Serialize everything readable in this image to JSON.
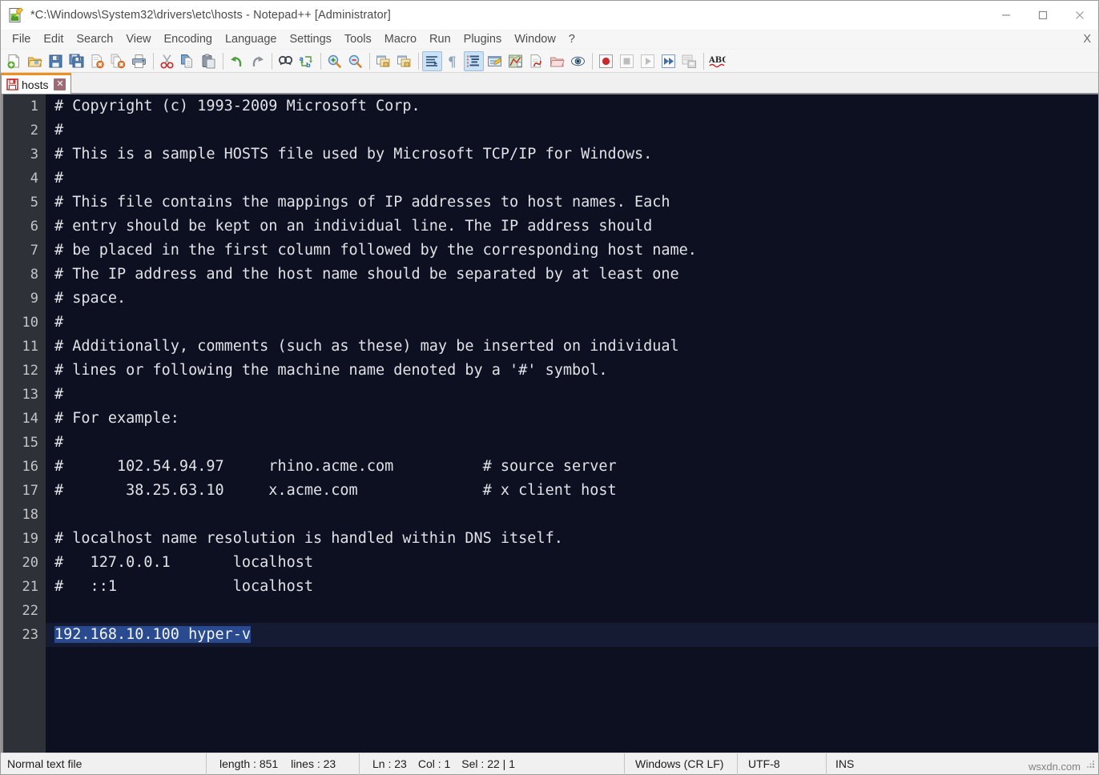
{
  "window": {
    "title": "*C:\\Windows\\System32\\drivers\\etc\\hosts - Notepad++ [Administrator]",
    "icon": "notepad-plus-plus-document-icon",
    "controls": {
      "minimize": "—",
      "maximize": "□",
      "close": "✕"
    }
  },
  "menubar": {
    "items": [
      {
        "label": "File"
      },
      {
        "label": "Edit"
      },
      {
        "label": "Search"
      },
      {
        "label": "View"
      },
      {
        "label": "Encoding"
      },
      {
        "label": "Language"
      },
      {
        "label": "Settings"
      },
      {
        "label": "Tools"
      },
      {
        "label": "Macro"
      },
      {
        "label": "Run"
      },
      {
        "label": "Plugins"
      },
      {
        "label": "Window"
      },
      {
        "label": "?"
      }
    ],
    "close_document_label": "X"
  },
  "toolbar": {
    "buttons": [
      {
        "name": "new-file-icon",
        "title": "New"
      },
      {
        "name": "open-file-icon",
        "title": "Open"
      },
      {
        "name": "save-icon",
        "title": "Save"
      },
      {
        "name": "save-all-icon",
        "title": "Save All"
      },
      {
        "name": "close-file-icon",
        "title": "Close"
      },
      {
        "name": "close-all-files-icon",
        "title": "Close All"
      },
      {
        "name": "print-icon",
        "title": "Print"
      },
      {
        "name": "separator-1",
        "title": ""
      },
      {
        "name": "cut-icon",
        "title": "Cut"
      },
      {
        "name": "copy-icon",
        "title": "Copy"
      },
      {
        "name": "paste-icon",
        "title": "Paste"
      },
      {
        "name": "separator-2",
        "title": ""
      },
      {
        "name": "undo-icon",
        "title": "Undo"
      },
      {
        "name": "redo-icon",
        "title": "Redo"
      },
      {
        "name": "separator-3",
        "title": ""
      },
      {
        "name": "find-icon",
        "title": "Find"
      },
      {
        "name": "replace-icon",
        "title": "Replace"
      },
      {
        "name": "separator-4",
        "title": ""
      },
      {
        "name": "zoom-in-icon",
        "title": "Zoom In"
      },
      {
        "name": "zoom-out-icon",
        "title": "Zoom Out"
      },
      {
        "name": "separator-5",
        "title": ""
      },
      {
        "name": "sync-vertical-scroll-icon",
        "title": "Synchronize Vertical Scrolling"
      },
      {
        "name": "sync-horizontal-scroll-icon",
        "title": "Synchronize Horizontal Scrolling"
      },
      {
        "name": "separator-6",
        "title": ""
      },
      {
        "name": "word-wrap-icon",
        "title": "Word wrap",
        "active": true
      },
      {
        "name": "show-all-characters-icon",
        "title": "Show All Characters"
      },
      {
        "name": "indent-guide-icon",
        "title": "Show Indent Guide",
        "active": true
      },
      {
        "name": "user-defined-language-icon",
        "title": "User-Defined Dialogue"
      },
      {
        "name": "document-map-icon",
        "title": "Document Map"
      },
      {
        "name": "function-list-icon",
        "title": "Function List"
      },
      {
        "name": "folder-as-workspace-icon",
        "title": "Folder as Workspace"
      },
      {
        "name": "document-monitoring-icon",
        "title": "Monitoring"
      },
      {
        "name": "separator-7",
        "title": ""
      },
      {
        "name": "record-macro-icon",
        "title": "Start Recording"
      },
      {
        "name": "stop-macro-icon",
        "title": "Stop Recording"
      },
      {
        "name": "play-macro-icon",
        "title": "Playback"
      },
      {
        "name": "run-macro-multiple-icon",
        "title": "Run a Macro Multiple Times"
      },
      {
        "name": "save-macro-icon",
        "title": "Save Currently Recorded Macro"
      },
      {
        "name": "separator-8",
        "title": ""
      },
      {
        "name": "spell-check-icon",
        "title": "Spell Checker"
      }
    ]
  },
  "tabs": [
    {
      "label": "hosts",
      "icon": "unsaved-floppy-icon",
      "close": "✕",
      "active": true,
      "accent": "#ef8f20"
    }
  ],
  "editor": {
    "theme": {
      "background": "#0c1021",
      "text": "#dfe2e6",
      "gutter_background": "#2e3238",
      "gutter_text": "#c3c4c6",
      "selection": "#2a4a8f",
      "current_line": "#151b33"
    },
    "lines": [
      {
        "n": "1",
        "text": "# Copyright (c) 1993-2009 Microsoft Corp."
      },
      {
        "n": "2",
        "text": "#"
      },
      {
        "n": "3",
        "text": "# This is a sample HOSTS file used by Microsoft TCP/IP for Windows."
      },
      {
        "n": "4",
        "text": "#"
      },
      {
        "n": "5",
        "text": "# This file contains the mappings of IP addresses to host names. Each"
      },
      {
        "n": "6",
        "text": "# entry should be kept on an individual line. The IP address should"
      },
      {
        "n": "7",
        "text": "# be placed in the first column followed by the corresponding host name."
      },
      {
        "n": "8",
        "text": "# The IP address and the host name should be separated by at least one"
      },
      {
        "n": "9",
        "text": "# space."
      },
      {
        "n": "10",
        "text": "#"
      },
      {
        "n": "11",
        "text": "# Additionally, comments (such as these) may be inserted on individual"
      },
      {
        "n": "12",
        "text": "# lines or following the machine name denoted by a '#' symbol."
      },
      {
        "n": "13",
        "text": "#"
      },
      {
        "n": "14",
        "text": "# For example:"
      },
      {
        "n": "15",
        "text": "#"
      },
      {
        "n": "16",
        "text": "#      102.54.94.97     rhino.acme.com          # source server"
      },
      {
        "n": "17",
        "text": "#       38.25.63.10     x.acme.com              # x client host"
      },
      {
        "n": "18",
        "text": ""
      },
      {
        "n": "19",
        "text": "# localhost name resolution is handled within DNS itself."
      },
      {
        "n": "20",
        "text": "#   127.0.0.1       localhost"
      },
      {
        "n": "21",
        "text": "#   ::1             localhost"
      },
      {
        "n": "22",
        "text": ""
      },
      {
        "n": "23",
        "text": "192.168.10.100 hyper-v",
        "selected": true,
        "current": true
      }
    ]
  },
  "statusbar": {
    "file_type": "Normal text file",
    "length_label": "length : 851",
    "lines_label": "lines : 23",
    "ln": "Ln : 23",
    "col": "Col : 1",
    "sel": "Sel : 22 | 1",
    "eol": "Windows (CR LF)",
    "encoding": "UTF-8",
    "insert_mode": "INS",
    "watermark": "wsxdn.com"
  }
}
